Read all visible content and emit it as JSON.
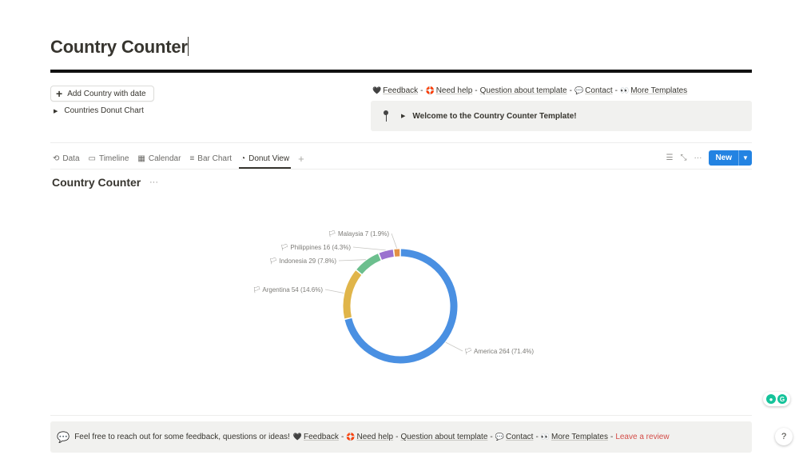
{
  "page": {
    "title": "Country Counter"
  },
  "actions": {
    "add_button_label": "Add Country with date",
    "toggle_label": "Countries Donut Chart"
  },
  "links": {
    "feedback": "Feedback",
    "need_help": "Need help",
    "question": "Question about template",
    "contact": "Contact",
    "more_templates": "More Templates",
    "separator": "-"
  },
  "callout": {
    "text": "Welcome to the Country Counter Template!"
  },
  "views": {
    "tabs": [
      {
        "label": "Data",
        "icon": "history-icon"
      },
      {
        "label": "Timeline",
        "icon": "timeline-icon"
      },
      {
        "label": "Calendar",
        "icon": "calendar-icon"
      },
      {
        "label": "Bar Chart",
        "icon": "bar-chart-icon"
      },
      {
        "label": "Donut View",
        "icon": "donut-icon",
        "active": true
      }
    ],
    "add_tab": "+",
    "new_button_label": "New",
    "view_title": "Country Counter",
    "view_more": "···"
  },
  "chart_data": {
    "type": "pie",
    "donut": true,
    "slices": [
      {
        "label": "America",
        "value": 264,
        "percent": "71.4%",
        "color": "#4a90e2"
      },
      {
        "label": "Argentina",
        "value": 54,
        "percent": "14.6%",
        "color": "#e0b54a"
      },
      {
        "label": "Indonesia",
        "value": 29,
        "percent": "7.8%",
        "color": "#6cbf8e"
      },
      {
        "label": "Philippines",
        "value": 16,
        "percent": "4.3%",
        "color": "#9b72cf"
      },
      {
        "label": "Malaysia",
        "value": 7,
        "percent": "1.9%",
        "color": "#e39145"
      }
    ]
  },
  "footer": {
    "text": "Feel free to reach out for some feedback, questions or ideas!",
    "feedback": "Feedback",
    "need_help": "Need help",
    "question": "Question about template",
    "contact": "Contact",
    "more_templates": "More Templates",
    "leave_review": "Leave a review",
    "separator": "-"
  },
  "colors": {
    "accent": "#2383e2",
    "review_link": "#d44c47",
    "callout_bg": "#f1f1ef"
  }
}
